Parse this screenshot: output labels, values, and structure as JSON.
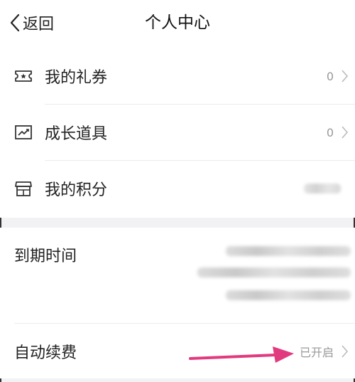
{
  "header": {
    "back_label": "返回",
    "title": "个人中心"
  },
  "menu": {
    "coupons": {
      "label": "我的礼券",
      "value": "0",
      "icon": "ticket-icon"
    },
    "growth_tools": {
      "label": "成长道具",
      "value": "0",
      "icon": "trend-chart-icon"
    },
    "points": {
      "label": "我的积分",
      "icon": "store-icon"
    }
  },
  "membership": {
    "expire_label": "到期时间",
    "auto_renew_label": "自动续费",
    "auto_renew_value": "已开启"
  },
  "colors": {
    "annotation_arrow": "#e23a7e",
    "muted_text": "#999999",
    "background": "#f2f2f4"
  }
}
